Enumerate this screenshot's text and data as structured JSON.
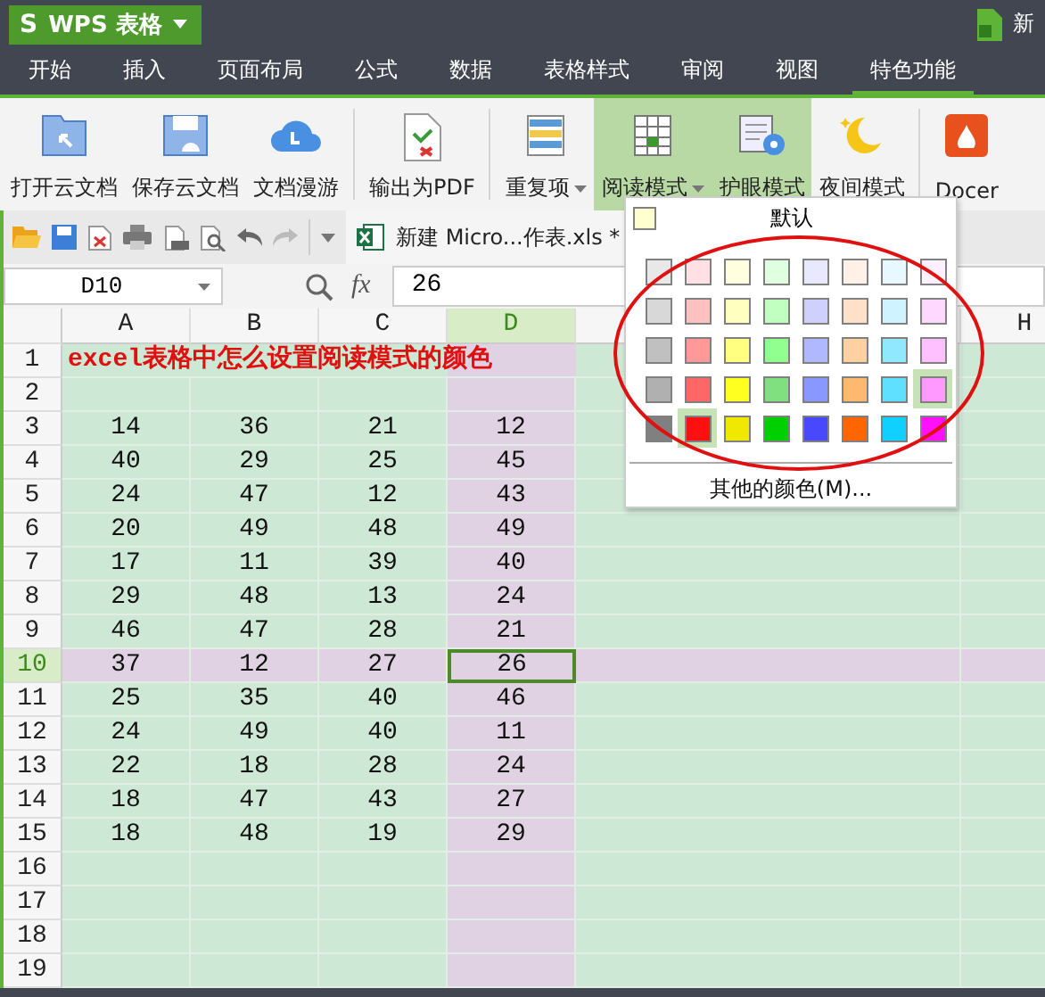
{
  "app_button": {
    "logo": "S",
    "label": "WPS 表格"
  },
  "document_title": "新",
  "menu_tabs": [
    {
      "label": "开始",
      "selected": false
    },
    {
      "label": "插入",
      "selected": false
    },
    {
      "label": "页面布局",
      "selected": false
    },
    {
      "label": "公式",
      "selected": false
    },
    {
      "label": "数据",
      "selected": false
    },
    {
      "label": "表格样式",
      "selected": false
    },
    {
      "label": "审阅",
      "selected": false
    },
    {
      "label": "视图",
      "selected": false
    },
    {
      "label": "特色功能",
      "selected": true
    }
  ],
  "ribbon_groups": [
    [
      {
        "label": "打开云文档",
        "selected": false,
        "dropdown": false
      },
      {
        "label": "保存云文档",
        "selected": false,
        "dropdown": false
      },
      {
        "label": "文档漫游",
        "selected": false,
        "dropdown": false
      }
    ],
    [
      {
        "label": "输出为PDF",
        "selected": false,
        "dropdown": false
      }
    ],
    [
      {
        "label": "重复项",
        "selected": false,
        "dropdown": true
      },
      {
        "label": "阅读模式",
        "selected": true,
        "dropdown": true
      },
      {
        "label": "护眼模式",
        "selected": true,
        "dropdown": false
      },
      {
        "label": "夜间模式",
        "selected": false,
        "dropdown": false
      }
    ],
    [
      {
        "label": "Docer",
        "selected": false,
        "dropdown": false
      }
    ]
  ],
  "document_tab": "新建 Micro...作表.xls *",
  "formula_bar": {
    "name_box": "D10",
    "fx": "fx",
    "value": "26"
  },
  "sheet": {
    "columns": [
      {
        "label": "A",
        "selected": false
      },
      {
        "label": "B",
        "selected": false
      },
      {
        "label": "C",
        "selected": false
      },
      {
        "label": "D",
        "selected": true
      }
    ],
    "last_column": {
      "label": "H",
      "selected": false
    },
    "rows": [
      {
        "label": "1",
        "selected": false,
        "title": "excel表格中怎么设置阅读模式的颜色",
        "cells": []
      },
      {
        "label": "2",
        "selected": false,
        "cells": []
      },
      {
        "label": "3",
        "selected": false,
        "cells": [
          "14",
          "36",
          "21",
          "12"
        ]
      },
      {
        "label": "4",
        "selected": false,
        "cells": [
          "40",
          "29",
          "25",
          "45"
        ]
      },
      {
        "label": "5",
        "selected": false,
        "cells": [
          "24",
          "47",
          "12",
          "43"
        ]
      },
      {
        "label": "6",
        "selected": false,
        "cells": [
          "20",
          "49",
          "48",
          "49"
        ]
      },
      {
        "label": "7",
        "selected": false,
        "cells": [
          "17",
          "11",
          "39",
          "40"
        ]
      },
      {
        "label": "8",
        "selected": false,
        "cells": [
          "29",
          "48",
          "13",
          "24"
        ]
      },
      {
        "label": "9",
        "selected": false,
        "cells": [
          "46",
          "47",
          "28",
          "21"
        ]
      },
      {
        "label": "10",
        "selected": true,
        "cells": [
          "37",
          "12",
          "27",
          "26"
        ]
      },
      {
        "label": "11",
        "selected": false,
        "cells": [
          "25",
          "35",
          "40",
          "46"
        ]
      },
      {
        "label": "12",
        "selected": false,
        "cells": [
          "24",
          "49",
          "40",
          "11"
        ]
      },
      {
        "label": "13",
        "selected": false,
        "cells": [
          "22",
          "18",
          "28",
          "24"
        ]
      },
      {
        "label": "14",
        "selected": false,
        "cells": [
          "18",
          "47",
          "43",
          "27"
        ]
      },
      {
        "label": "15",
        "selected": false,
        "cells": [
          "18",
          "48",
          "19",
          "29"
        ]
      },
      {
        "label": "16",
        "selected": false,
        "cells": []
      },
      {
        "label": "17",
        "selected": false,
        "cells": []
      },
      {
        "label": "18",
        "selected": false,
        "cells": []
      },
      {
        "label": "19",
        "selected": false,
        "cells": []
      }
    ]
  },
  "color_menu": {
    "default_label": "默认",
    "swatches": [
      [
        {
          "color": "#e8e8e8",
          "selected": false
        },
        {
          "color": "#ffe0e4",
          "selected": false
        },
        {
          "color": "#ffffe0",
          "selected": false
        },
        {
          "color": "#e0ffe0",
          "selected": false
        },
        {
          "color": "#e8e8ff",
          "selected": false
        },
        {
          "color": "#fff0e8",
          "selected": false
        },
        {
          "color": "#e8f8ff",
          "selected": false
        },
        {
          "color": "#fff0ff",
          "selected": false
        }
      ],
      [
        {
          "color": "#d8d8d8",
          "selected": false
        },
        {
          "color": "#ffc0c0",
          "selected": false
        },
        {
          "color": "#ffffc0",
          "selected": false
        },
        {
          "color": "#c0ffc0",
          "selected": false
        },
        {
          "color": "#d0d0ff",
          "selected": false
        },
        {
          "color": "#ffe0c8",
          "selected": false
        },
        {
          "color": "#d0f4ff",
          "selected": false
        },
        {
          "color": "#ffd8ff",
          "selected": false
        }
      ],
      [
        {
          "color": "#c0c0c0",
          "selected": false
        },
        {
          "color": "#ff9898",
          "selected": false
        },
        {
          "color": "#ffff80",
          "selected": false
        },
        {
          "color": "#90ff90",
          "selected": false
        },
        {
          "color": "#b0b8ff",
          "selected": false
        },
        {
          "color": "#ffd0a0",
          "selected": false
        },
        {
          "color": "#90e8ff",
          "selected": false
        },
        {
          "color": "#ffc0ff",
          "selected": false
        }
      ],
      [
        {
          "color": "#b0b0b0",
          "selected": false
        },
        {
          "color": "#ff6666",
          "selected": false
        },
        {
          "color": "#ffff20",
          "selected": false
        },
        {
          "color": "#80e080",
          "selected": false
        },
        {
          "color": "#8898ff",
          "selected": false
        },
        {
          "color": "#ffb870",
          "selected": false
        },
        {
          "color": "#60e0ff",
          "selected": false
        },
        {
          "color": "#ff98ff",
          "selected": true
        }
      ],
      [
        {
          "color": "#808080",
          "selected": false
        },
        {
          "color": "#ff1010",
          "selected": true
        },
        {
          "color": "#f0e800",
          "selected": false
        },
        {
          "color": "#00d000",
          "selected": false
        },
        {
          "color": "#4848ff",
          "selected": false
        },
        {
          "color": "#ff6600",
          "selected": false
        },
        {
          "color": "#10d0ff",
          "selected": false
        },
        {
          "color": "#ff10ff",
          "selected": false
        }
      ]
    ],
    "more_colors": "其他的颜色(M)..."
  }
}
